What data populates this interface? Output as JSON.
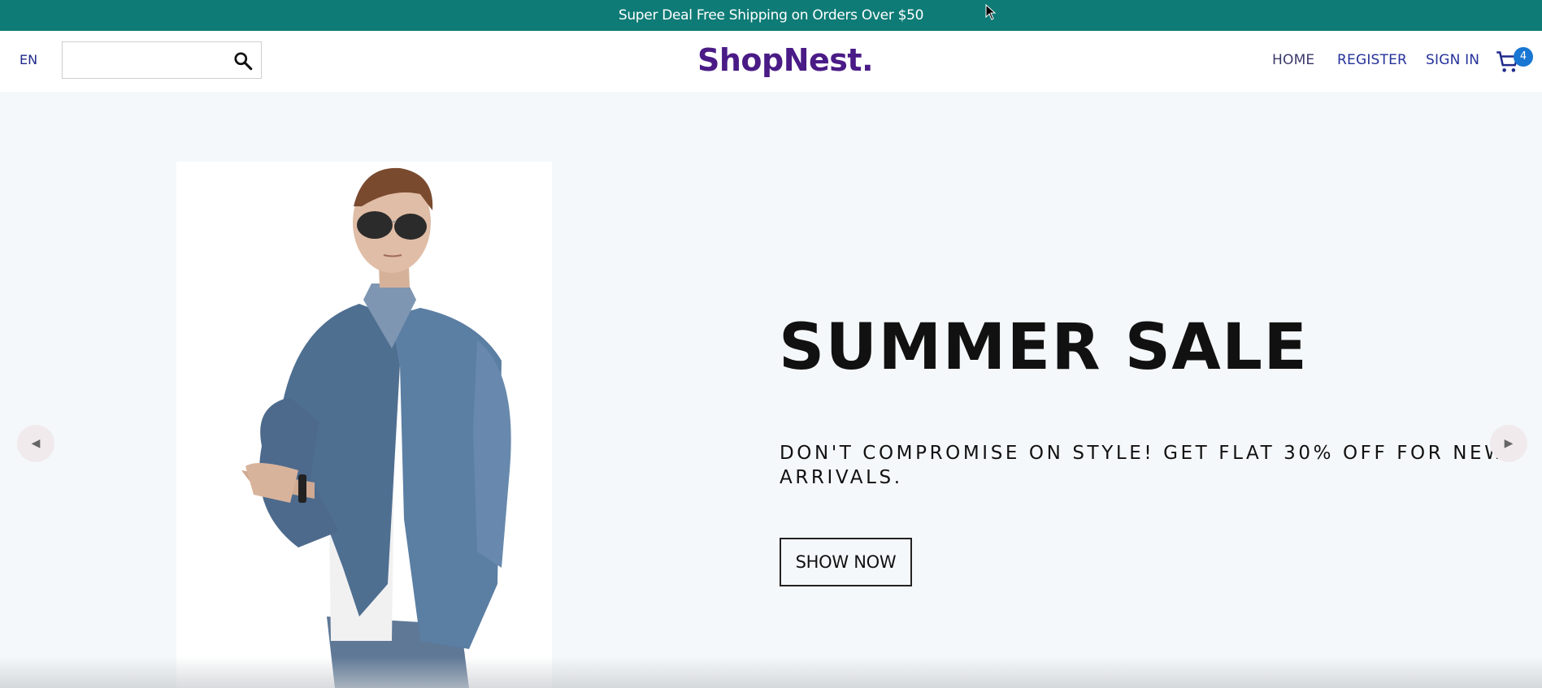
{
  "announcement": {
    "text": "Super Deal Free Shipping on Orders Over $50",
    "bg_color": "#0e7b76"
  },
  "header": {
    "language": "EN",
    "search": {
      "placeholder": "",
      "value": "",
      "icon": "search-icon"
    },
    "logo": "ShopNest.",
    "logo_color": "#4a1b86",
    "menu": {
      "home": "HOME",
      "register": "REGISTER",
      "sign_in": "SIGN IN"
    },
    "cart": {
      "icon": "shopping-cart-icon",
      "count": "4",
      "badge_color": "#1976d2"
    }
  },
  "hero": {
    "title": "SUMMER SALE",
    "description": "DON'T COMPROMISE ON STYLE! GET FLAT 30% OFF FOR NEW ARRIVALS.",
    "button_label": "SHOW NOW",
    "prev_icon": "caret-left-icon",
    "next_icon": "caret-right-icon",
    "background_color": "#f5f8fa"
  }
}
